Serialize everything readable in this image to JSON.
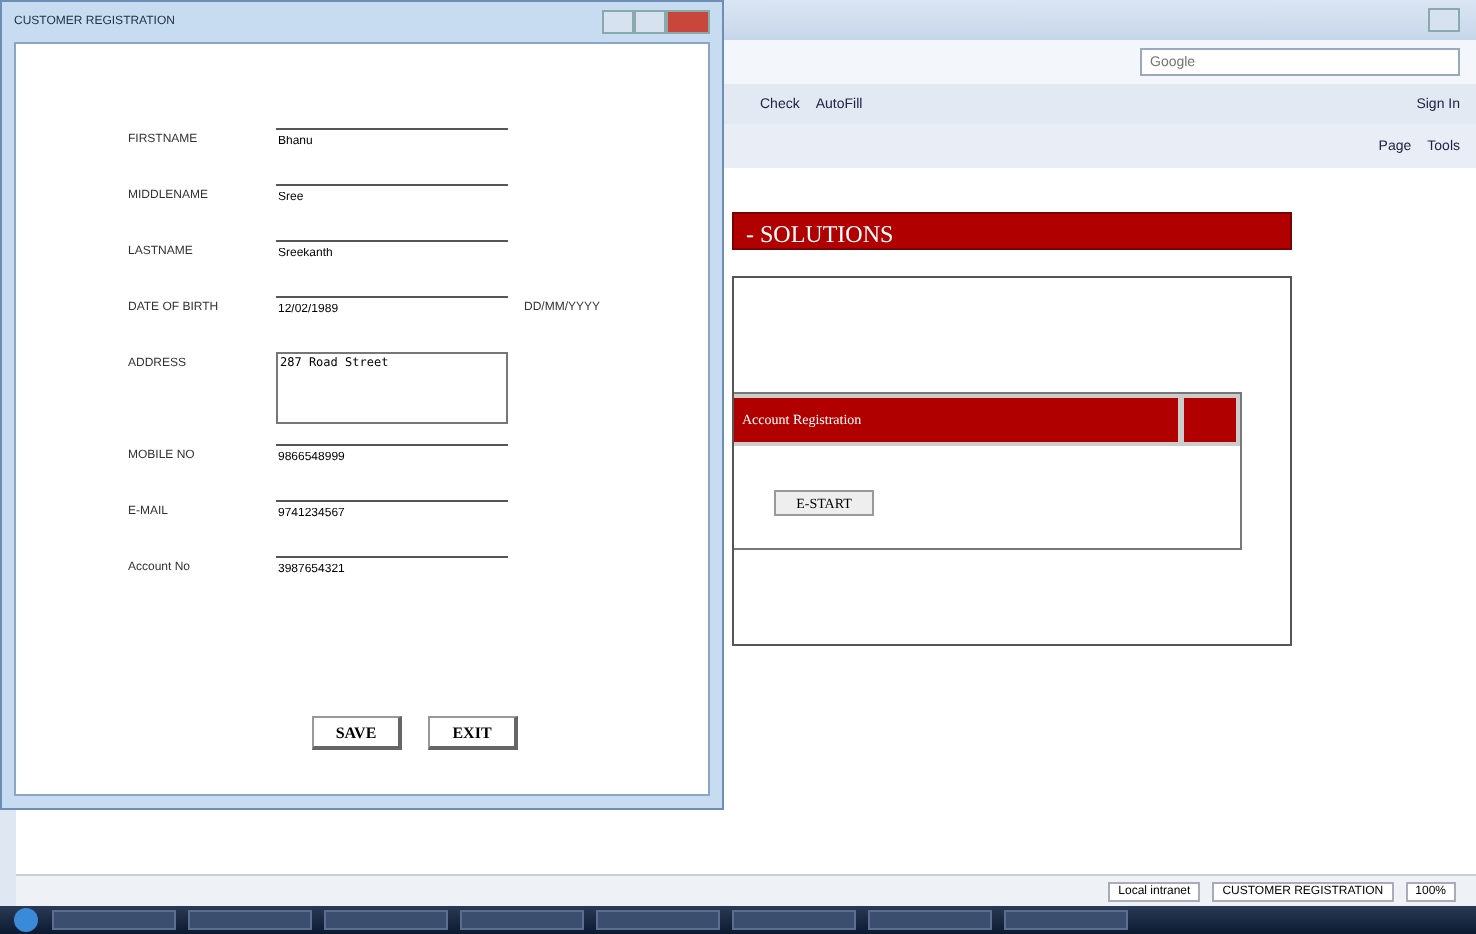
{
  "dialog": {
    "title": "CUSTOMER REGISTRATION",
    "fields": [
      {
        "kind": "line",
        "label": "FIRSTNAME",
        "value": "Bhanu"
      },
      {
        "kind": "line",
        "label": "MIDDLENAME",
        "value": "Sree"
      },
      {
        "kind": "line",
        "label": "LASTNAME",
        "value": "Sreekanth"
      },
      {
        "kind": "line",
        "label": "DATE OF BIRTH",
        "value": "12/02/1989",
        "hint": "DD/MM/YYYY"
      },
      {
        "kind": "area",
        "label": "ADDRESS",
        "value": "287 Road Street"
      },
      {
        "kind": "line",
        "label": "MOBILE NO",
        "value": "9866548999"
      },
      {
        "kind": "line",
        "label": "E-MAIL",
        "value": "9741234567"
      },
      {
        "kind": "line",
        "label": "Account No",
        "value": "3987654321"
      }
    ],
    "buttons": [
      "SAVE",
      "EXIT"
    ]
  },
  "browser": {
    "search": {
      "placeholder": "Google"
    },
    "toolbar": [
      "Check",
      "AutoFill"
    ],
    "sign_in": "Sign In",
    "commands": [
      "Page",
      "Tools"
    ],
    "banner": "- SOLUTIONS",
    "panel_header": "Account Registration",
    "start_button": "E-START",
    "status_bar": {
      "zone": "Local intranet",
      "task": "CUSTOMER REGISTRATION",
      "zoom": "100%"
    }
  }
}
